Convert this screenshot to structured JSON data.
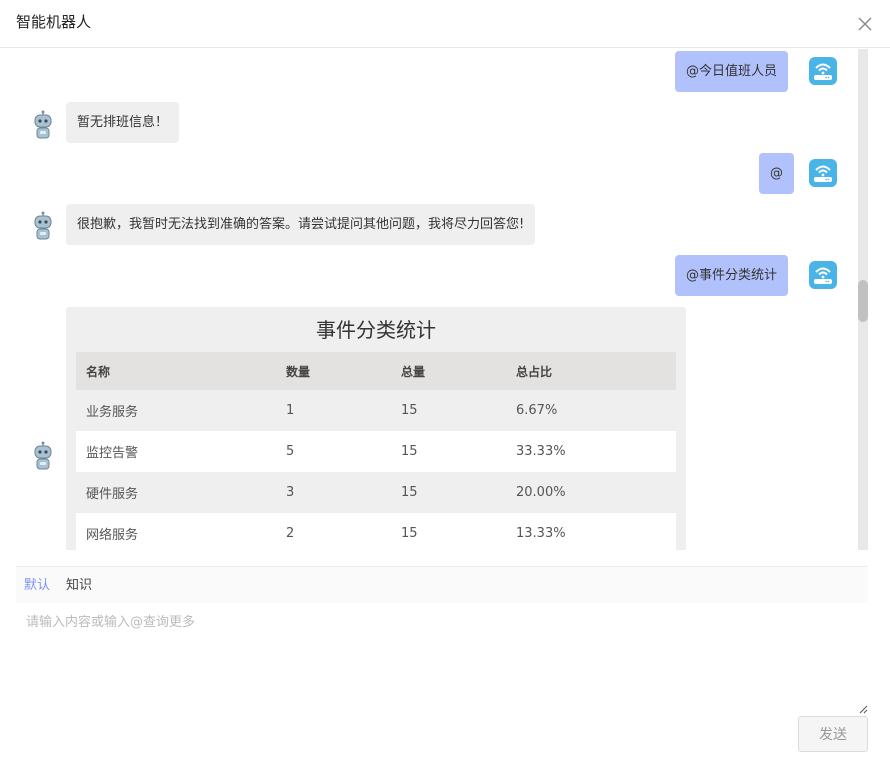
{
  "window": {
    "title": "智能机器人",
    "close_icon": "close-icon"
  },
  "messages": [
    {
      "from": "user",
      "text": "@今日值班人员"
    },
    {
      "from": "bot",
      "text": "暂无排班信息！"
    },
    {
      "from": "user",
      "text": "@"
    },
    {
      "from": "bot",
      "text": "很抱歉，我暂时无法找到准确的答案。请尝试提问其他问题，我将尽力回答您!"
    },
    {
      "from": "user",
      "text": "@事件分类统计"
    }
  ],
  "stats_table": {
    "title": "事件分类统计",
    "headers": [
      "名称",
      "数量",
      "总量",
      "总占比"
    ],
    "rows": [
      [
        "业务服务",
        "1",
        "15",
        "6.67%"
      ],
      [
        "监控告警",
        "5",
        "15",
        "33.33%"
      ],
      [
        "硬件服务",
        "3",
        "15",
        "20.00%"
      ],
      [
        "网络服务",
        "2",
        "15",
        "13.33%"
      ]
    ]
  },
  "tabs": {
    "default": "默认",
    "knowledge": "知识",
    "active": "默认"
  },
  "composer": {
    "placeholder": "请输入内容或输入@查询更多",
    "value": ""
  },
  "send_button": {
    "label": "发送"
  },
  "colors": {
    "user_bubble": "#b1c1fb",
    "bot_bubble": "#efefef",
    "active_tab": "#7b93f7"
  }
}
